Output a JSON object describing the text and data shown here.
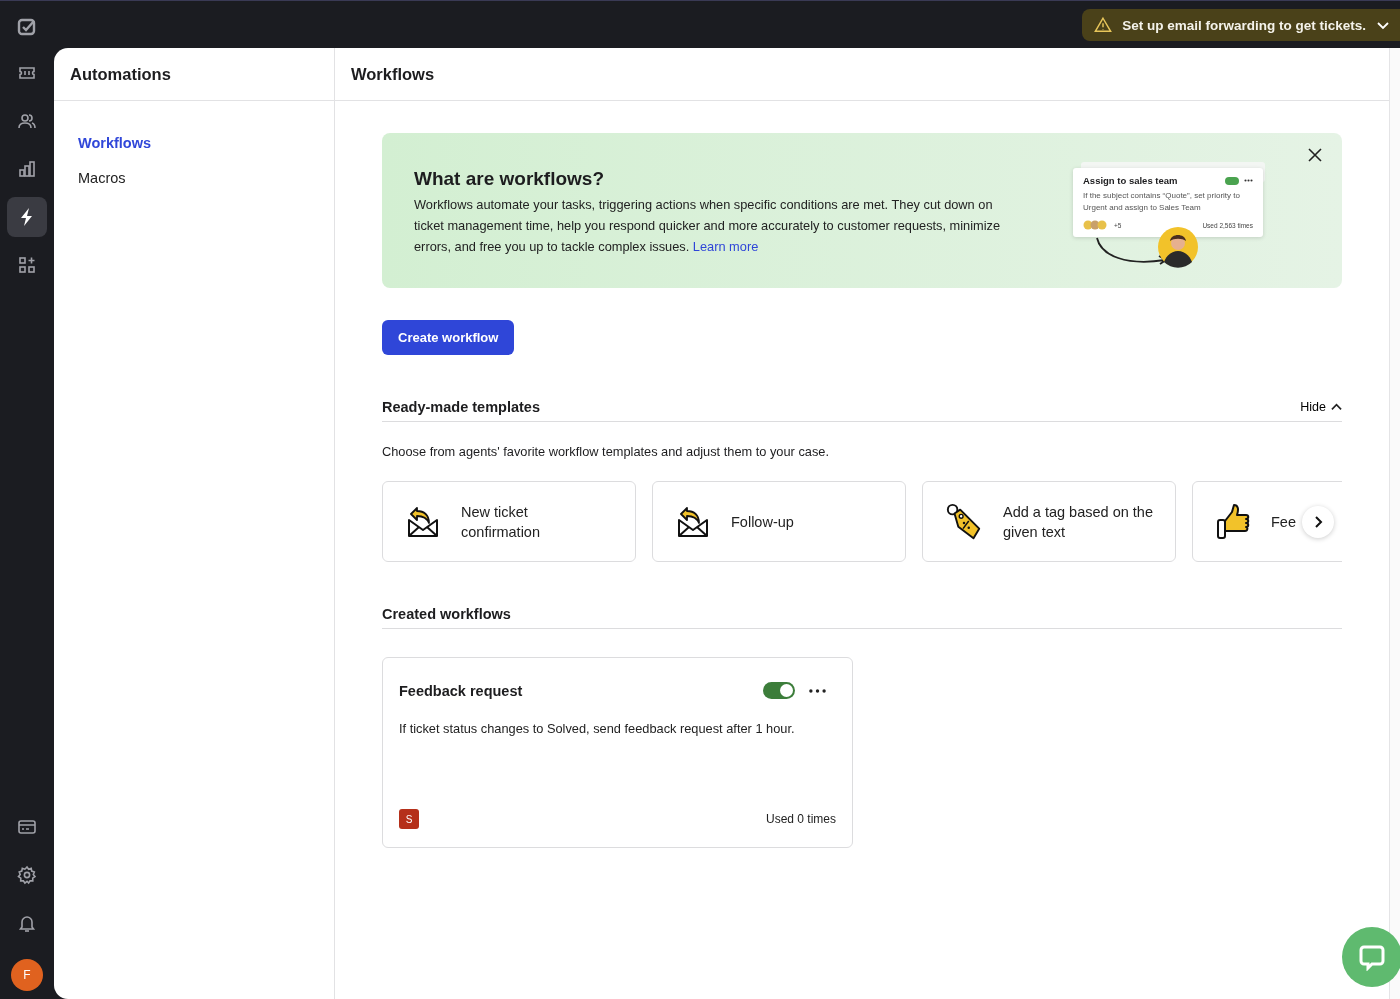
{
  "rail": {
    "items": [
      {
        "selected": false
      },
      {
        "selected": false
      },
      {
        "selected": false
      },
      {
        "selected": true
      },
      {
        "selected": false
      }
    ],
    "bottom_items": [
      {
        "selected": false
      },
      {
        "selected": false
      },
      {
        "selected": false
      }
    ],
    "avatar": {
      "initial": "F",
      "color": "#e0621f"
    }
  },
  "notice": {
    "text": "Set up email forwarding to get tickets."
  },
  "sidebar": {
    "title": "Automations",
    "items": [
      {
        "label": "Workflows",
        "selected": true
      },
      {
        "label": "Macros",
        "selected": false
      }
    ]
  },
  "page": {
    "title": "Workflows"
  },
  "intro": {
    "title": "What are workflows?",
    "text": "Workflows automate your tasks, triggering actions when specific conditions are met. They cut down on ticket management time, help you respond quicker and more accurately to customer requests, minimize errors, and free you up to tackle complex issues.",
    "link": "Learn more",
    "illustration": {
      "title": "Assign to sales team",
      "on": true,
      "text": "If the subject contains “Quote”, set priority to Urgent and assign to Sales Team",
      "extra": "+5",
      "usage": "Used 2,563 times"
    }
  },
  "create_button": "Create workflow",
  "templates": {
    "heading": "Ready-made templates",
    "toggle": "Hide",
    "description": "Choose from agents' favorite workflow templates and adjust them to your case.",
    "items": [
      {
        "label": "New ticket confirmation",
        "kind": "reply-mail"
      },
      {
        "label": "Follow-up",
        "kind": "reply-mail"
      },
      {
        "label": "Add a tag based on the given text",
        "kind": "tag"
      },
      {
        "label": "Fee",
        "kind": "thumbs"
      }
    ]
  },
  "created": {
    "heading": "Created workflows",
    "workflows": [
      {
        "title": "Feedback request",
        "on": true,
        "description": "If ticket status changes to Solved, send feedback request after 1 hour.",
        "owner": {
          "initial": "S",
          "color": "#b5301a"
        },
        "usage": "Used 0 times"
      }
    ]
  }
}
